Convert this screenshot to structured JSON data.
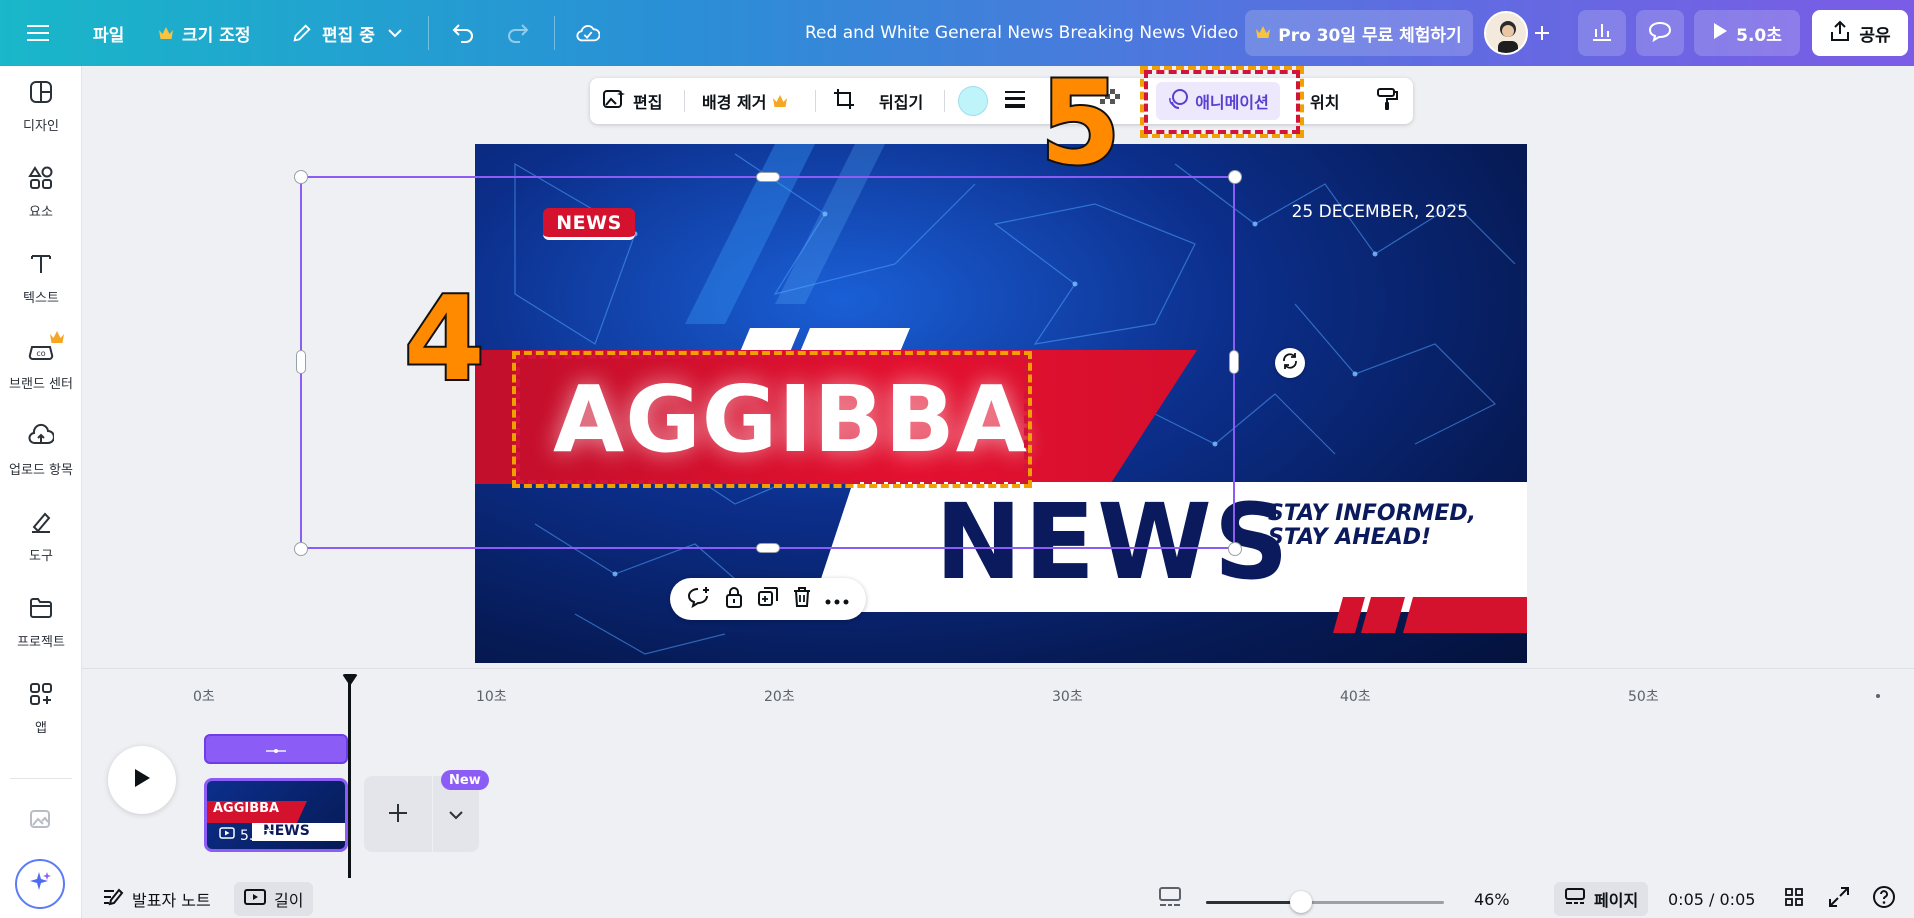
{
  "topbar": {
    "file": "파일",
    "resize": "크기 조정",
    "editing": "편집 중",
    "doc_title": "Red and White General News Breaking News Video",
    "pro_trial": "Pro 30일 무료 체험하기",
    "play_duration": "5.0초",
    "share": "공유"
  },
  "sidebar": {
    "items": [
      {
        "label": "디자인",
        "icon": "design-icon"
      },
      {
        "label": "요소",
        "icon": "elements-icon"
      },
      {
        "label": "텍스트",
        "icon": "text-icon"
      },
      {
        "label": "브랜드 센터",
        "icon": "brand-icon"
      },
      {
        "label": "업로드 항목",
        "icon": "upload-icon"
      },
      {
        "label": "도구",
        "icon": "tools-icon"
      },
      {
        "label": "프로젝트",
        "icon": "folder-icon"
      },
      {
        "label": "앱",
        "icon": "apps-icon"
      }
    ]
  },
  "context_toolbar": {
    "edit": "편집",
    "bg_remove": "배경 제거",
    "flip": "뒤집기",
    "animation": "애니메이션",
    "position": "위치"
  },
  "canvas": {
    "tag": "NEWS",
    "date": "25 DECEMBER, 2025",
    "headline": "AGGIBBA",
    "subheadline": "NEWS",
    "tagline_1": "STAY INFORMED,",
    "tagline_2": "STAY AHEAD!"
  },
  "annotations": {
    "step_4": "4",
    "step_5": "5",
    "outline_color": "#f0a000",
    "inner_color": "#d3143a"
  },
  "timeline": {
    "ruler": [
      "0초",
      "10초",
      "20초",
      "30초",
      "40초",
      "50초"
    ],
    "clip_duration": "5.0초",
    "clip_headline": "AGGIBBA",
    "clip_sub": "NEWS",
    "new_badge": "New"
  },
  "bottombar": {
    "notes": "발표자 노트",
    "length": "길이",
    "zoom": "46%",
    "pages": "페이지",
    "time": "0:05 / 0:05"
  },
  "colors": {
    "accent": "#8b5cf6",
    "brand_red": "#d5122e",
    "navy": "#0b1a5c"
  }
}
